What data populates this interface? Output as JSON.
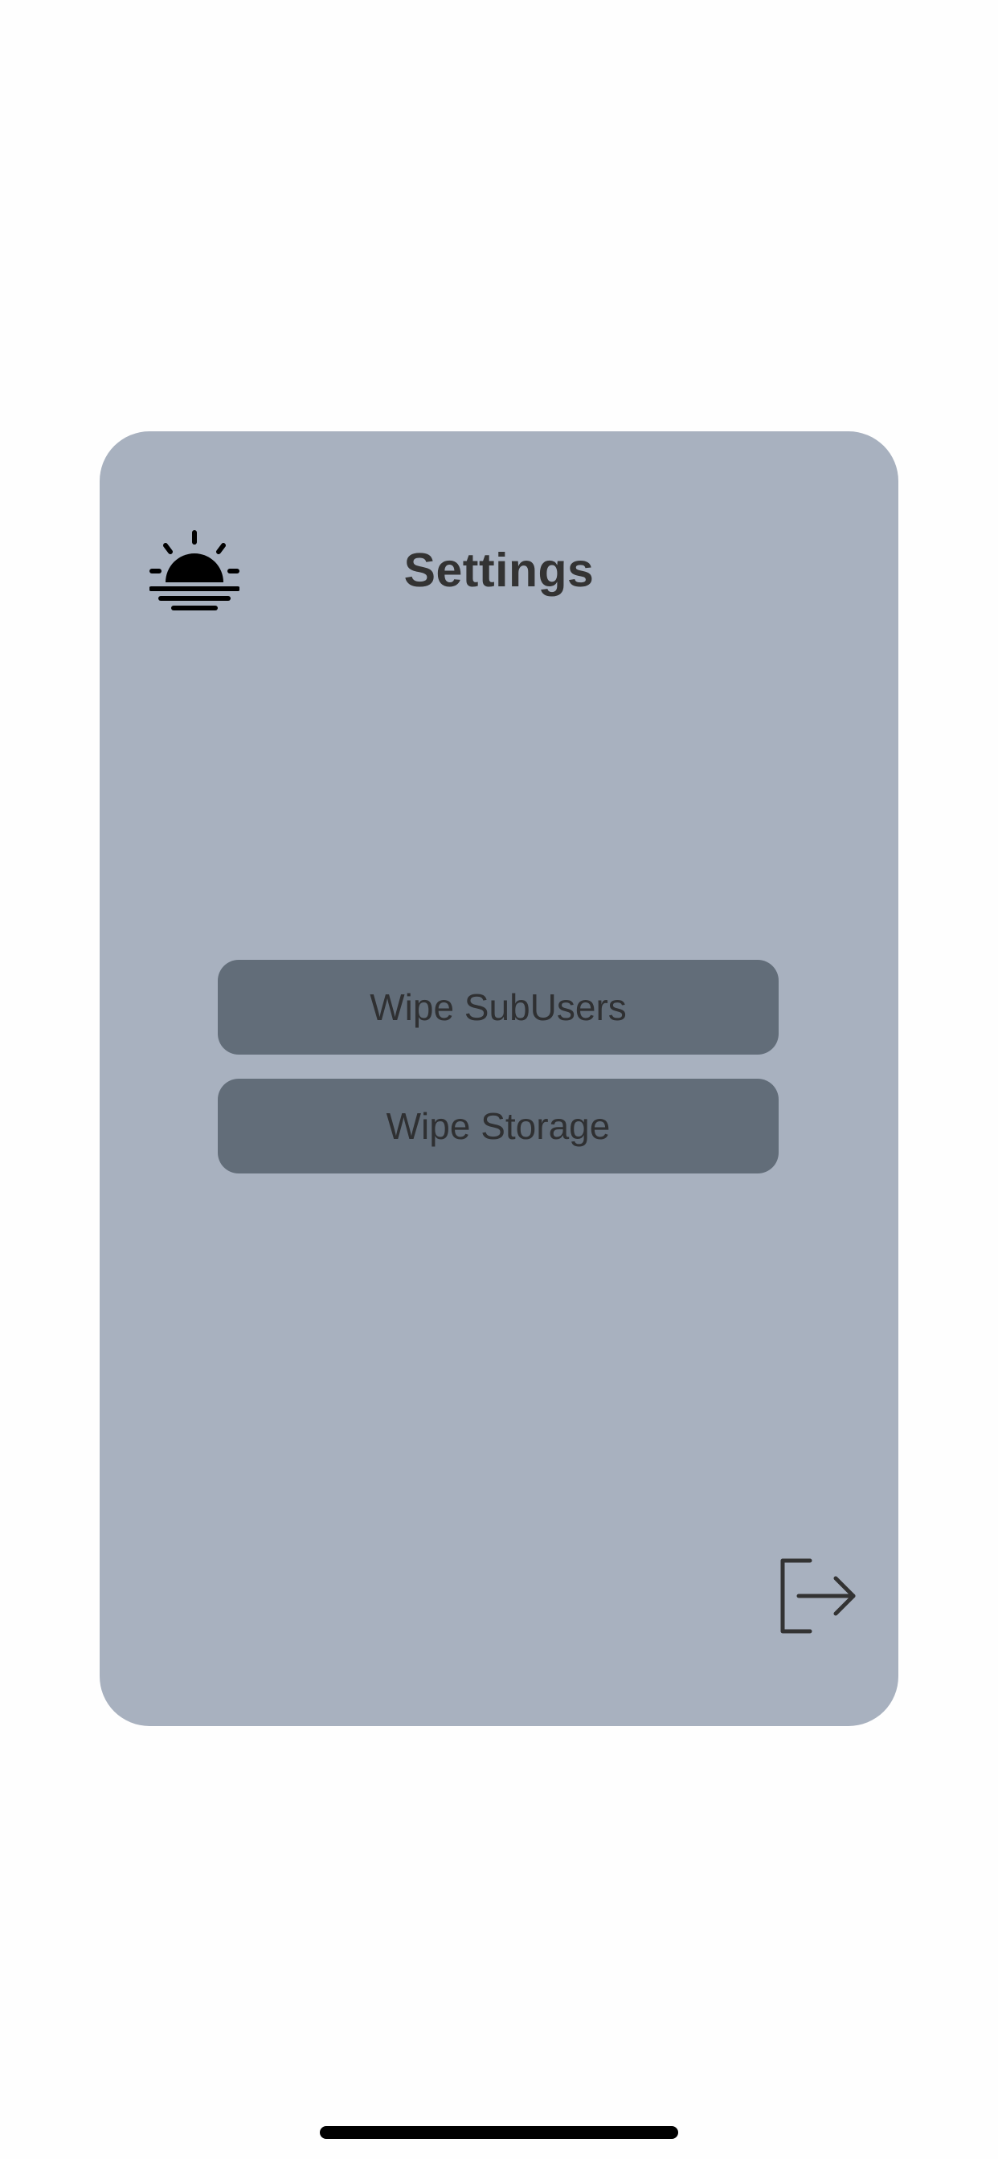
{
  "header": {
    "title": "Settings",
    "theme_icon": "sunset-icon"
  },
  "actions": {
    "wipe_subusers_label": "Wipe SubUsers",
    "wipe_storage_label": "Wipe Storage"
  },
  "footer": {
    "logout_icon": "logout-icon"
  },
  "colors": {
    "page_background": "#fefefe",
    "card_background": "#a8b1bf",
    "button_background": "#626d79",
    "text_dark": "#333333"
  }
}
